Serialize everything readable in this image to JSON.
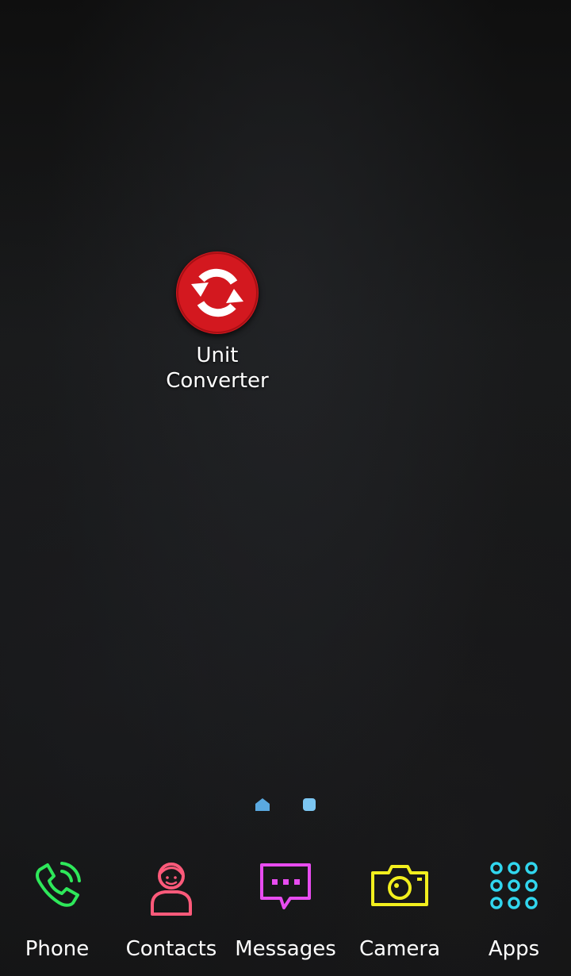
{
  "home_screen": {
    "apps": [
      {
        "label_line1": "Unit",
        "label_line2": "Converter",
        "icon": "unit-converter-icon",
        "color": "#d3181f"
      }
    ]
  },
  "page_indicator": {
    "pages": [
      "home",
      "page-2"
    ],
    "color": "#5aa9e0"
  },
  "dock": {
    "items": [
      {
        "label": "Phone",
        "icon": "phone-icon",
        "color": "#2ee85a"
      },
      {
        "label": "Contacts",
        "icon": "contact-icon",
        "color": "#ff5a7a"
      },
      {
        "label": "Messages",
        "icon": "message-icon",
        "color": "#e84cf0"
      },
      {
        "label": "Camera",
        "icon": "camera-icon",
        "color": "#f2ef1e"
      },
      {
        "label": "Apps",
        "icon": "apps-grid-icon",
        "color": "#31d6ee"
      }
    ]
  }
}
